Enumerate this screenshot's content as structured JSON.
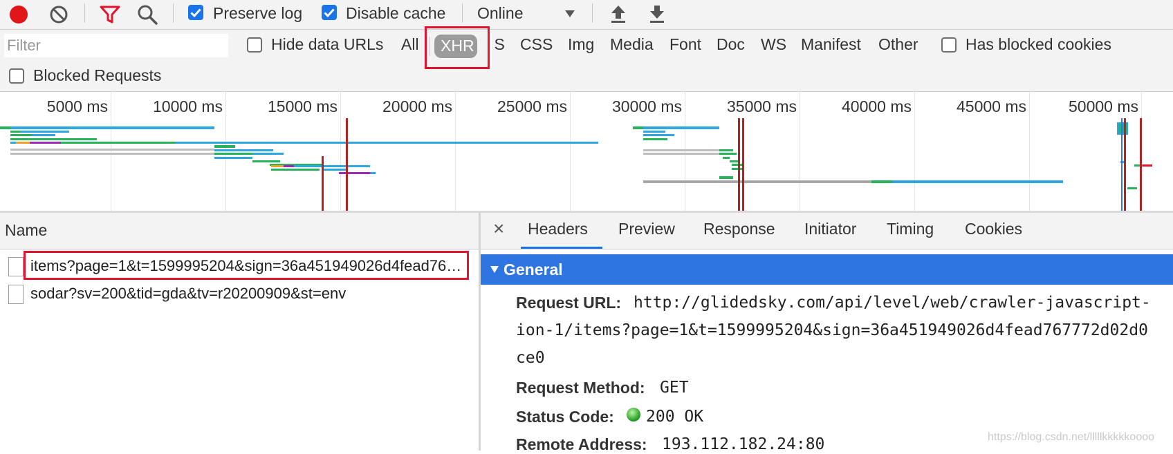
{
  "toolbar": {
    "preserve_log": "Preserve log",
    "disable_cache": "Disable cache",
    "throttle": "Online",
    "colors": {
      "record": "#e0161b",
      "filter_active": "#e3142d",
      "checkbox": "#1a73e8"
    }
  },
  "filterbar": {
    "placeholder": "Filter",
    "hide_data_urls": "Hide data URLs",
    "types": [
      "All",
      "XHR",
      "JS",
      "CSS",
      "Img",
      "Media",
      "Font",
      "Doc",
      "WS",
      "Manifest",
      "Other"
    ],
    "selected_type": "XHR",
    "has_blocked_cookies": "Has blocked cookies",
    "blocked_requests": "Blocked Requests"
  },
  "overview": {
    "ticks": [
      "5000 ms",
      "10000 ms",
      "15000 ms",
      "20000 ms",
      "25000 ms",
      "30000 ms",
      "35000 ms",
      "40000 ms",
      "45000 ms",
      "50000 ms"
    ]
  },
  "requests": {
    "column": "Name",
    "rows": [
      "items?page=1&t=1599995204&sign=36a451949026d4fead767772d02d0ce0",
      "sodar?sv=200&tid=gda&tv=r20200909&st=env"
    ]
  },
  "details": {
    "close": "×",
    "tabs": [
      "Headers",
      "Preview",
      "Response",
      "Initiator",
      "Timing",
      "Cookies"
    ],
    "active_tab": "Headers",
    "section": "General",
    "request_url_label": "Request URL:",
    "request_url_lines": [
      "http://glidedsky.com/api/level/web/crawler-javascript-",
      "ion-1/items?page=1&t=1599995204&sign=36a451949026d4fead767772d02d0",
      "ce0"
    ],
    "request_method_label": "Request Method:",
    "request_method": "GET",
    "status_code_label": "Status Code:",
    "status_code": "200 OK",
    "remote_address_label": "Remote Address:",
    "remote_address": "193.112.182.24:80"
  },
  "watermark": "https://blog.csdn.net/lllllkkkkkoooo"
}
